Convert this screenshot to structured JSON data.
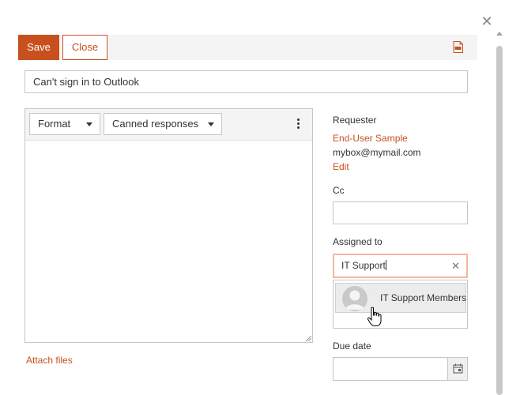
{
  "dialog": {
    "close_icon": "close-icon"
  },
  "toolbar": {
    "save_label": "Save",
    "close_label": "Close",
    "pdf_icon": "pdf-icon",
    "accent_color": "#c8501e"
  },
  "subject": {
    "value": "Can't sign in to Outlook"
  },
  "editor": {
    "format_label": "Format",
    "canned_label": "Canned responses",
    "more_icon": "more-vertical-icon",
    "body": ""
  },
  "attach": {
    "label": "Attach files"
  },
  "requester": {
    "label": "Requester",
    "name": "End-User Sample",
    "email": "mybox@mymail.com",
    "edit_label": "Edit"
  },
  "cc": {
    "label": "Cc",
    "value": ""
  },
  "assigned": {
    "label": "Assigned to",
    "value": "IT Support",
    "clear_icon": "clear-icon",
    "suggestions": [
      {
        "name": "IT Support Members",
        "icon": "avatar-icon"
      }
    ]
  },
  "due_date": {
    "label": "Due date",
    "value": "",
    "calendar_icon": "calendar-icon"
  }
}
